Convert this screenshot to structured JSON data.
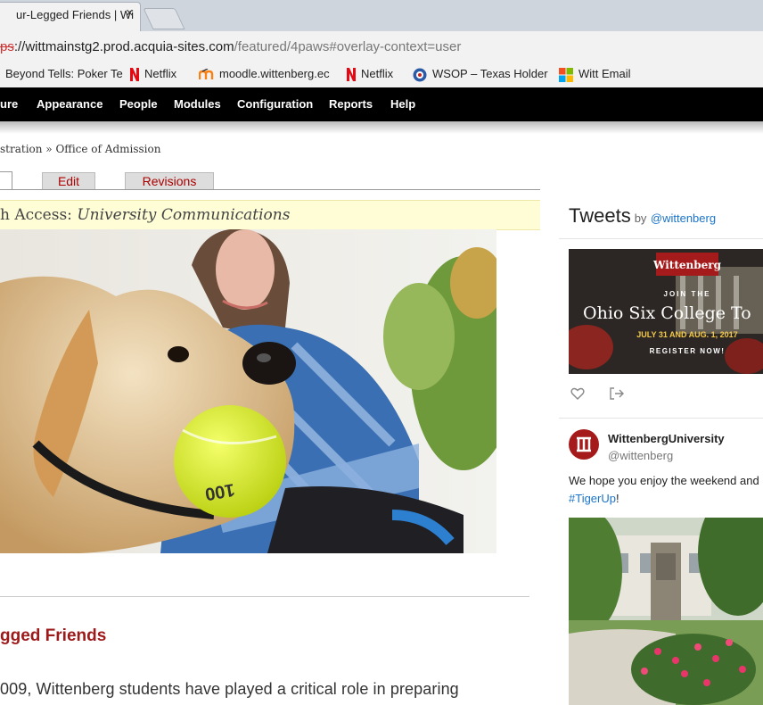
{
  "browser": {
    "tab_title": "ur-Legged Friends | Wi",
    "tab_close": "×",
    "url_protocol": "ps",
    "url_host": "://wittmainstg2.prod.acquia-sites.com",
    "url_path": "/featured/4paws#overlay-context=user",
    "bookmarks": [
      {
        "label": "Beyond Tells: Poker Te",
        "icon": "web-icon"
      },
      {
        "label": "Netflix",
        "icon": "netflix-icon"
      },
      {
        "label": "moodle.wittenberg.ec",
        "icon": "moodle-icon"
      },
      {
        "label": "Netflix",
        "icon": "netflix-icon"
      },
      {
        "label": "WSOP – Texas Holder",
        "icon": "poker-chip-icon"
      },
      {
        "label": "Witt Email",
        "icon": "windows-icon"
      }
    ]
  },
  "admin_menu": [
    "ure",
    "Appearance",
    "People",
    "Modules",
    "Configuration",
    "Reports",
    "Help"
  ],
  "breadcrumb": "stration » Office of Admission",
  "page_tabs": {
    "edit": "Edit",
    "revisions": "Revisions"
  },
  "access": {
    "prefix": "h Access: ",
    "value": "University Communications"
  },
  "hero": {
    "ball_text": "100"
  },
  "story": {
    "title": "gged Friends",
    "body_first_line": "009, Wittenberg students have played a critical role in preparing"
  },
  "twitter": {
    "heading": "Tweets",
    "by": "by",
    "handle_link": "@wittenberg",
    "card": {
      "logo": "Wittenberg",
      "join": "JOIN THE",
      "headline": "Ohio Six College To",
      "dates": "JULY 31 AND AUG. 1, 2017",
      "register": "REGISTER NOW!"
    },
    "user_name": "WittenbergUniversity",
    "user_handle": "@wittenberg",
    "tweet_text": "We hope you enjoy the weekend and",
    "hashtag": "#TigerUp",
    "hashtag_tail": "!"
  },
  "colors": {
    "link": "#1b74c9",
    "title": "#9c1a1a",
    "tab_text": "#aa0000",
    "toolbar": "#000000"
  }
}
